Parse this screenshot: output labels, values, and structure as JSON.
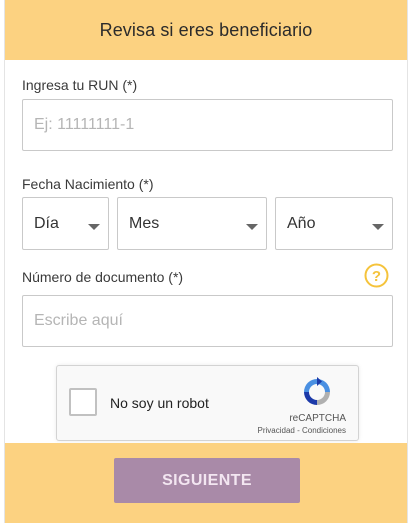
{
  "header": {
    "title": "Revisa si eres beneficiario"
  },
  "run": {
    "label": "Ingresa tu RUN (*)",
    "placeholder": "Ej: 11111111-1",
    "value": ""
  },
  "birth": {
    "label": "Fecha Nacimiento (*)",
    "day": "Día",
    "month": "Mes",
    "year": "Año"
  },
  "document": {
    "label": "Número de documento (*)",
    "placeholder": "Escribe aquí",
    "value": "",
    "help_icon": "question-circle-icon"
  },
  "captcha": {
    "label": "No soy un robot",
    "brand": "reCAPTCHA",
    "links": "Privacidad - Condiciones",
    "checked": false
  },
  "footer": {
    "submit_label": "SIGUIENTE"
  },
  "colors": {
    "accent": "#fcd281",
    "button": "#a98aa8",
    "help_icon": "#f5c33b"
  }
}
